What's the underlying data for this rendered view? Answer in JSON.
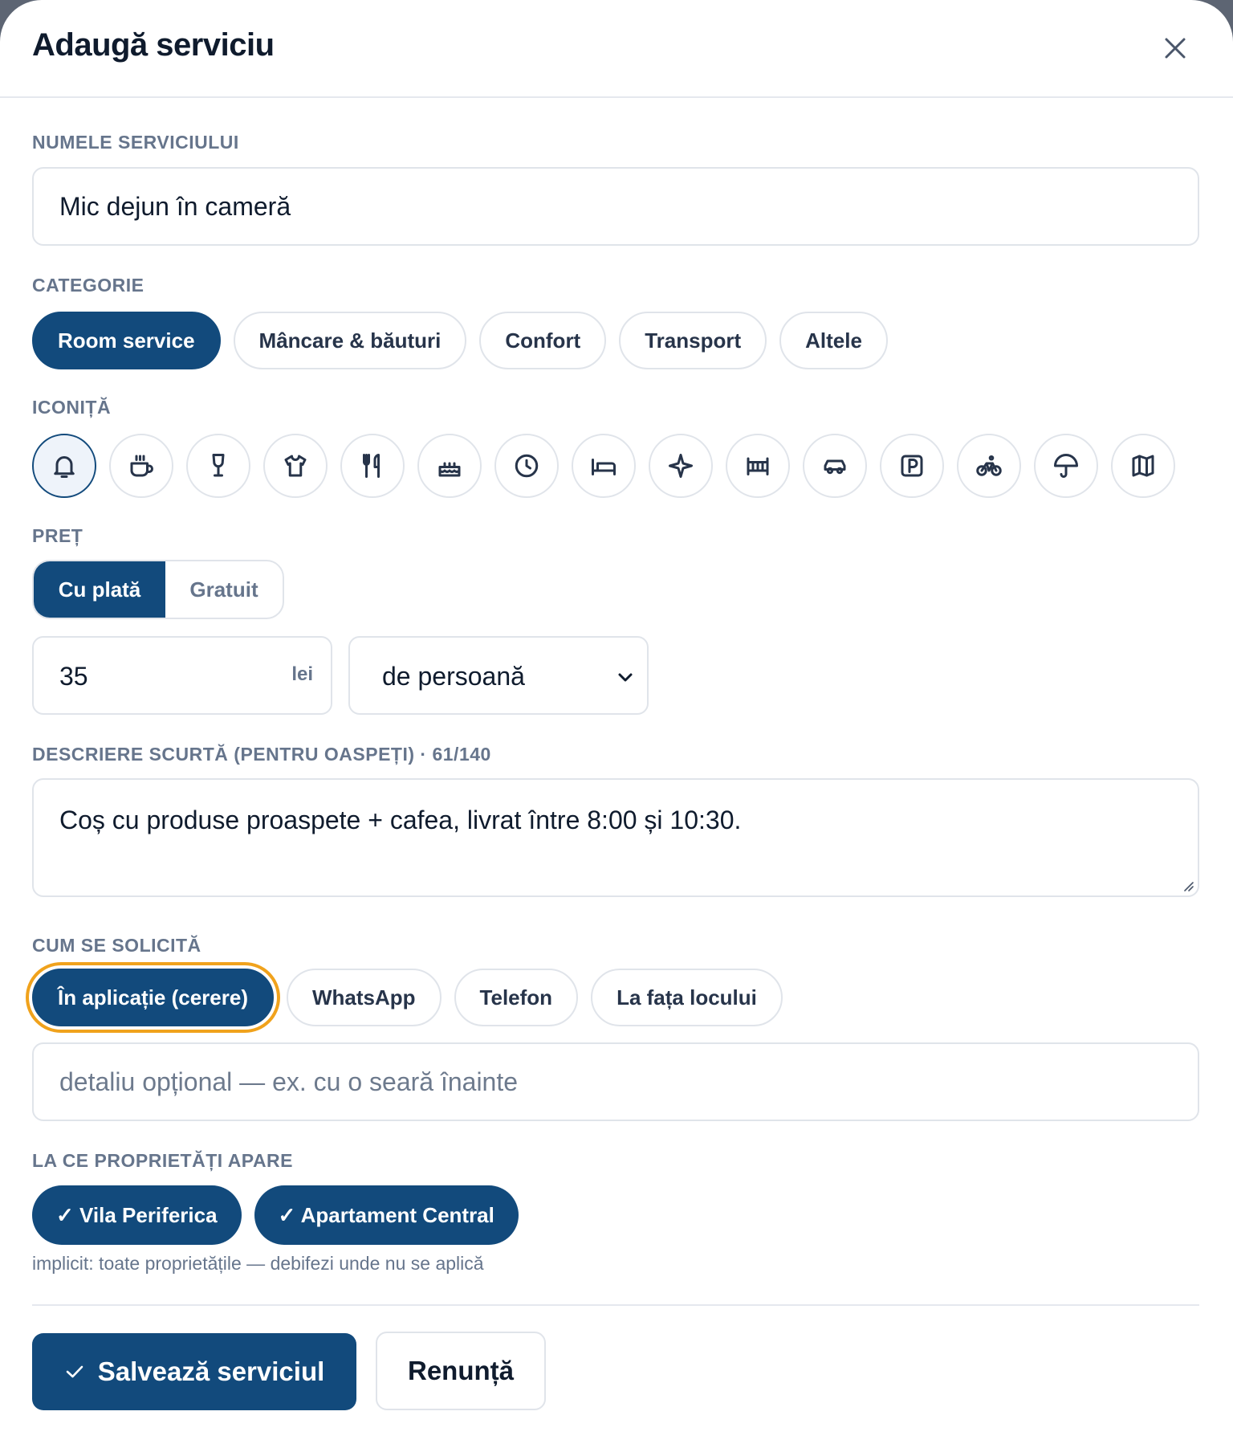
{
  "modal": {
    "title": "Adaugă serviciu"
  },
  "name_section": {
    "label": "NUMELE SERVICIULUI",
    "value": "Mic dejun în cameră"
  },
  "category_section": {
    "label": "CATEGORIE",
    "options": [
      "Room service",
      "Mâncare & băuturi",
      "Confort",
      "Transport",
      "Altele"
    ],
    "selected": "Room service"
  },
  "icon_section": {
    "label": "ICONIȚĂ",
    "icons": [
      "bell-icon",
      "coffee-icon",
      "wine-glass-icon",
      "shirt-icon",
      "utensils-icon",
      "cake-icon",
      "clock-icon",
      "bed-icon",
      "sparkle-icon",
      "crib-icon",
      "car-icon",
      "parking-icon",
      "bicycle-icon",
      "umbrella-icon",
      "map-icon"
    ],
    "selected": "bell-icon"
  },
  "price_section": {
    "label": "PREȚ",
    "options": [
      "Cu plată",
      "Gratuit"
    ],
    "selected": "Cu plată",
    "amount": "35",
    "currency": "lei",
    "unit": "de persoană"
  },
  "description_section": {
    "label": "DESCRIERE SCURTĂ (PENTRU OASPEȚI) · 61/140",
    "value": "Coș cu produse proaspete + cafea, livrat între 8:00 și 10:30."
  },
  "request_section": {
    "label": "CUM SE SOLICITĂ",
    "options": [
      "În aplicație (cerere)",
      "WhatsApp",
      "Telefon",
      "La fața locului"
    ],
    "selected": "În aplicație (cerere)",
    "detail_placeholder": "detaliu opțional — ex. cu o seară înainte"
  },
  "properties_section": {
    "label": "LA CE PROPRIETĂȚI APARE",
    "properties": [
      "✓ Vila Periferica",
      "✓ Apartament Central"
    ],
    "hint": "implicit: toate proprietățile — debifezi unde nu se aplică"
  },
  "actions": {
    "save_label": "Salvează serviciul",
    "cancel_label": "Renunță"
  },
  "colors": {
    "accent": "#124a7c",
    "focus_ring": "#f0a21c",
    "label": "#66758c"
  }
}
